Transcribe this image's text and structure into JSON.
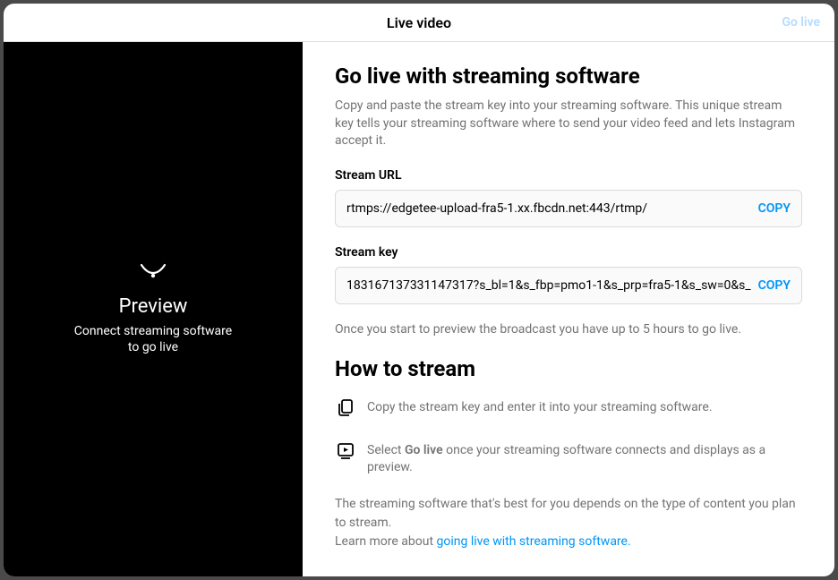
{
  "header": {
    "title": "Live video",
    "go_live": "Go live"
  },
  "preview": {
    "title": "Preview",
    "line1": "Connect streaming software",
    "line2": "to go live"
  },
  "main": {
    "heading": "Go live with streaming software",
    "description": "Copy and paste the stream key into your streaming software. This unique stream key tells your streaming software where to send your video feed and lets Instagram accept it.",
    "stream_url_label": "Stream URL",
    "stream_url_value": "rtmps://edgetee-upload-fra5-1.xx.fbcdn.net:443/rtmp/",
    "stream_key_label": "Stream key",
    "stream_key_value": "183167137331147317?s_bl=1&s_fbp=pmo1-1&s_prp=fra5-1&s_sw=0&s_",
    "copy_label": "COPY",
    "preview_note": "Once you start to preview the broadcast you have up to 5 hours to go live.",
    "how_to_heading": "How to stream",
    "step1": "Copy the stream key and enter it into your streaming software.",
    "step2_prefix": "Select ",
    "step2_bold": "Go live",
    "step2_suffix": " once your streaming software connects and displays as a preview.",
    "footer1": "The streaming software that's best for you depends on the type of content you plan to stream.",
    "footer2_prefix": "Learn more about ",
    "footer2_link": "going live with streaming software."
  }
}
